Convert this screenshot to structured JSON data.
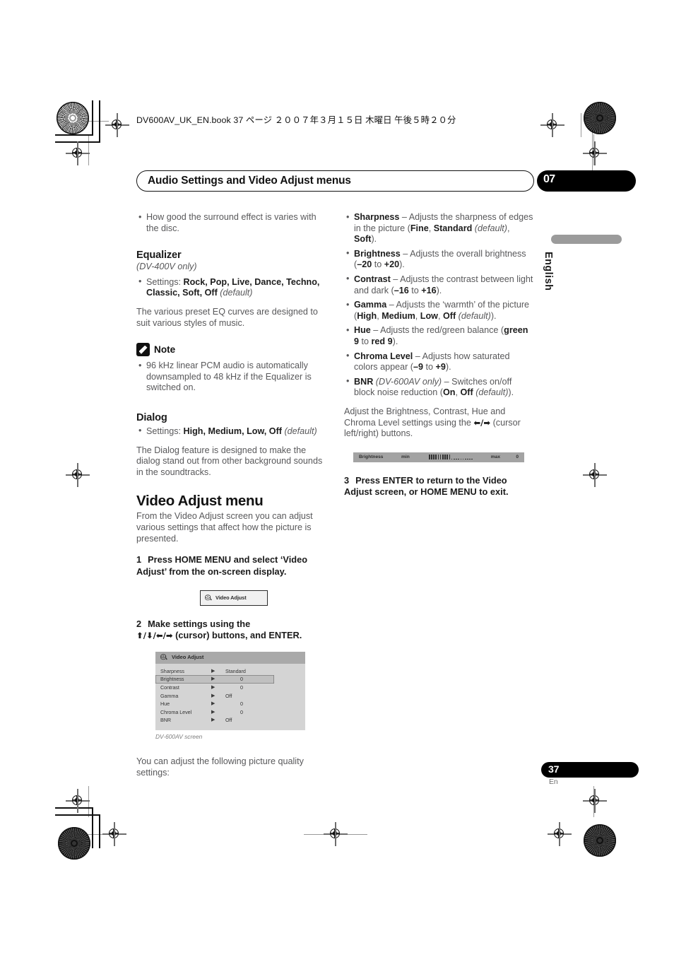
{
  "slug": "DV600AV_UK_EN.book  37 ページ  ２００７年３月１５日   木曜日   午後５時２０分",
  "header": {
    "running_title": "Audio Settings and Video Adjust menus",
    "chapter_number": "07"
  },
  "side_tab": {
    "language": "English"
  },
  "footer": {
    "page_number": "37",
    "page_lang": "En"
  },
  "left_column": {
    "intro_bullets": [
      "How good the surround effect is varies with the disc."
    ],
    "equalizer": {
      "heading": "Equalizer",
      "model_note": "(DV-400V only)",
      "settings_bullet_prefix": "Settings: ",
      "settings_values": "Rock, Pop, Live, Dance, Techno, Classic, Soft, Off",
      "settings_default": "(default)",
      "body": "The various preset EQ curves are designed to suit various styles of music."
    },
    "note": {
      "title": "Note",
      "icon": "pencil-note-icon",
      "bullets": [
        "96 kHz linear PCM audio is automatically downsampled to 48 kHz if the Equalizer is switched on."
      ]
    },
    "dialog": {
      "heading": "Dialog",
      "settings_bullet_prefix": "Settings: ",
      "settings_values": "High, Medium, Low, Off",
      "settings_default": "(default)",
      "body": "The Dialog feature is designed to make the dialog stand out from other background sounds in the soundtracks."
    },
    "video_adjust": {
      "heading": "Video Adjust menu",
      "body": "From the Video Adjust screen you can adjust various settings that affect how the picture is presented.",
      "step1_number": "1",
      "step1_text": "Press HOME MENU and select ‘Video Adjust’ from the on-screen display.",
      "osd_button_label": "Video Adjust",
      "osd_button_icon": "disc-stack-icon",
      "step2_number": "2",
      "step2_text_line1": "Make settings using the",
      "step2_cursor_glyphs": "⬆/⬇/⬅/➡",
      "step2_text_line2": "(cursor) buttons, and ENTER.",
      "screen": {
        "title": "Video Adjust",
        "title_icon": "disc-stack-icon",
        "arrow_glyph": "▶",
        "rows": [
          {
            "label": "Sharpness",
            "value": "Standard",
            "selected": false
          },
          {
            "label": "Brightness",
            "value": "0",
            "selected": true
          },
          {
            "label": "Contrast",
            "value": "0",
            "selected": false
          },
          {
            "label": "Gamma",
            "value": "Off",
            "selected": false
          },
          {
            "label": "Hue",
            "value": "0",
            "selected": false
          },
          {
            "label": "Chroma Level",
            "value": "0",
            "selected": false
          },
          {
            "label": "BNR",
            "value": "Off",
            "selected": false
          }
        ]
      },
      "screen_caption": "DV-600AV screen",
      "closing_text": "You can adjust the following picture quality settings:"
    }
  },
  "right_column": {
    "setting_bullets": [
      {
        "term": "Sharpness",
        "dash": " – ",
        "desc_before": "Adjusts the sharpness of edges in the picture (",
        "bold_a": "Fine",
        "mid_a": ", ",
        "bold_b": "Standard",
        "italic_default": "(default)",
        "mid_b": ", ",
        "bold_c": "Soft",
        "desc_after": ")."
      },
      {
        "term": "Brightness",
        "dash": " – ",
        "desc_before": "Adjusts the overall brightness (",
        "bold_a": "–20",
        "mid_a": " to ",
        "bold_b": "+20",
        "desc_after": ")."
      },
      {
        "term": "Contrast",
        "dash": " – ",
        "desc_before": "Adjusts the contrast between light and dark (",
        "bold_a": "–16",
        "mid_a": " to ",
        "bold_b": "+16",
        "desc_after": ")."
      },
      {
        "term": "Gamma",
        "dash": " – ",
        "desc_before": "Adjusts the ‘warmth’ of the picture (",
        "bold_a": "High",
        "mid_a": ", ",
        "bold_b": "Medium",
        "mid_b": ", ",
        "bold_c": "Low",
        "mid_c": ", ",
        "bold_d": "Off",
        "italic_default": "(default)",
        "desc_after": ")."
      },
      {
        "term": "Hue",
        "dash": " – ",
        "desc_before": "Adjusts the red/green balance (",
        "bold_a": "green 9",
        "mid_a": " to ",
        "bold_b": "red 9",
        "desc_after": ")."
      },
      {
        "term": "Chroma Level",
        "dash": " – ",
        "desc_before": "Adjusts how saturated colors appear (",
        "bold_a": "–9",
        "mid_a": " to ",
        "bold_b": "+9",
        "desc_after": ")."
      },
      {
        "term": "BNR",
        "model_note": "(DV-600AV only)",
        "dash": " – ",
        "desc_before": "Switches on/off block noise reduction (",
        "bold_a": "On",
        "mid_a": ", ",
        "bold_b": "Off",
        "italic_default": "(default)",
        "desc_after": ")."
      }
    ],
    "adjust_text_a": "Adjust the Brightness, Contrast, Hue and Chroma Level settings using the ",
    "adjust_cursor_glyphs": "⬅/➡",
    "adjust_text_b": " (cursor left/right) buttons.",
    "brightness_bar": {
      "label": "Brightness",
      "min_label": "min",
      "max_label": "max",
      "value": "0",
      "filled_ticks": 10,
      "empty_ticks": 10
    },
    "step3_number": "3",
    "step3_text": "Press ENTER to return to the Video Adjust screen, or HOME MENU to exit."
  }
}
